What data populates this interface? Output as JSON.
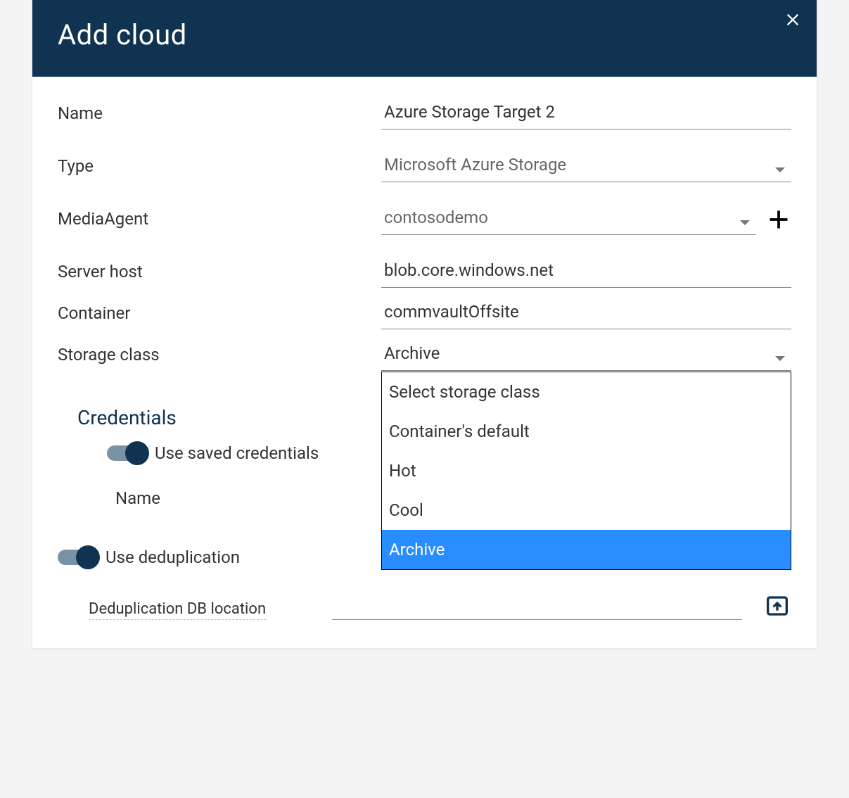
{
  "header": {
    "title": "Add cloud"
  },
  "fields": {
    "name": {
      "label": "Name",
      "value": "Azure Storage Target 2"
    },
    "type": {
      "label": "Type",
      "value": "Microsoft Azure Storage"
    },
    "mediaAgent": {
      "label": "MediaAgent",
      "value": "contosodemo"
    },
    "serverHost": {
      "label": "Server host",
      "value": "blob.core.windows.net"
    },
    "container": {
      "label": "Container",
      "value": "commvaultOffsite"
    },
    "storageClass": {
      "label": "Storage class",
      "value": "Archive",
      "options": [
        "Select storage class",
        "Container's default",
        "Hot",
        "Cool",
        "Archive"
      ],
      "selectedIndex": 4
    }
  },
  "credentials": {
    "title": "Credentials",
    "useSaved": {
      "label": "Use saved credentials",
      "on": true
    },
    "name": {
      "label": "Name"
    }
  },
  "dedup": {
    "toggle": {
      "label": "Use deduplication",
      "on": true
    },
    "dbLocation": {
      "label": "Deduplication DB location",
      "value": ""
    }
  }
}
